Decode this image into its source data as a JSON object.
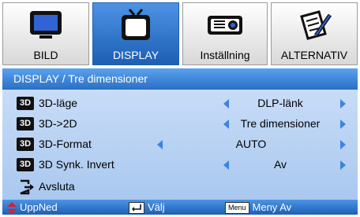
{
  "tabs": [
    {
      "label": "BILD",
      "icon": "monitor-icon",
      "active": false
    },
    {
      "label": "DISPLAY",
      "icon": "tv-icon",
      "active": true
    },
    {
      "label": "Inställning",
      "icon": "projector-icon",
      "active": false
    },
    {
      "label": "ALTERNATIV",
      "icon": "notepad-pen-icon",
      "active": false
    }
  ],
  "header": {
    "title": "DISPLAY / Tre dimensioner"
  },
  "rows": [
    {
      "badge": "3D",
      "label": "3D-läge",
      "value": "DLP-länk"
    },
    {
      "badge": "3D",
      "label": "3D->2D",
      "value": "Tre dimensioner"
    },
    {
      "badge": "3D",
      "label": "3D-Format",
      "value": "AUTO"
    },
    {
      "badge": "3D",
      "label": "3D Synk. Invert",
      "value": "Av"
    }
  ],
  "exit": {
    "label": "Avsluta"
  },
  "footer": {
    "updown_label": "UppNed",
    "enter_label": "Välj",
    "menu_key": "Menu",
    "menu_label": "Meny Av"
  },
  "colors": {
    "accent": "#2a6fc4",
    "panel": "#b8d2f3",
    "arrow": "#3c84dc",
    "updown": "#e0202a"
  }
}
